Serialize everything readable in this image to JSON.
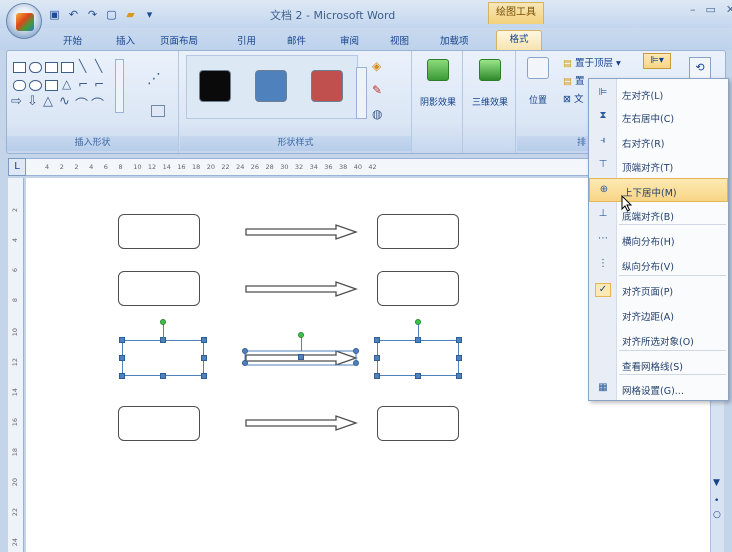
{
  "window": {
    "title": "文档 2 - Microsoft Word",
    "context_tab_group": "绘图工具",
    "controls": [
      "–",
      "▭",
      "✕"
    ]
  },
  "qat": {
    "icons": [
      "save-icon",
      "undo-icon",
      "redo-icon",
      "new-doc-icon",
      "open-folder-icon",
      "customize-qat-icon"
    ]
  },
  "tabs": [
    "开始",
    "插入",
    "页面布局",
    "引用",
    "邮件",
    "审阅",
    "视图",
    "加载项",
    "格式"
  ],
  "ribbon": {
    "groups": {
      "insert_shapes": "插入形状",
      "shape_styles": "形状样式",
      "shadow_effects": "阴影效果",
      "3d_effects": "三维效果",
      "position": "位置",
      "arrange_partial": "排"
    },
    "buttons": {
      "bring_front": "置于顶层",
      "send_back": "置",
      "text_wrap": "文",
      "shadow": "阴影效果",
      "threed": "三维效果",
      "position": "位置"
    },
    "swatch_colors": [
      "#0a0a0a",
      "#4f81bd",
      "#c0504d"
    ]
  },
  "ruler": {
    "ticks": [
      "4",
      "2",
      "2",
      "4",
      "6",
      "8",
      "10",
      "12",
      "14",
      "16",
      "18",
      "20",
      "22",
      "24",
      "26",
      "28",
      "30",
      "32",
      "34",
      "36",
      "38",
      "40",
      "42"
    ]
  },
  "vruler": {
    "ticks": [
      "2",
      "4",
      "6",
      "8",
      "10",
      "12",
      "14",
      "16",
      "18",
      "20",
      "22",
      "24"
    ]
  },
  "align_menu": {
    "items": [
      {
        "label": "左对齐(L)",
        "icon": "align-left-icon"
      },
      {
        "label": "左右居中(C)",
        "icon": "align-center-icon"
      },
      {
        "label": "右对齐(R)",
        "icon": "align-right-icon"
      },
      {
        "label": "顶端对齐(T)",
        "icon": "align-top-icon"
      },
      {
        "label": "上下居中(M)",
        "icon": "align-middle-icon",
        "highlighted": true
      },
      {
        "label": "底端对齐(B)",
        "icon": "align-bottom-icon"
      },
      {
        "label": "横向分布(H)",
        "icon": "distribute-horizontal-icon"
      },
      {
        "label": "纵向分布(V)",
        "icon": "distribute-vertical-icon"
      },
      {
        "label": "对齐页面(P)",
        "icon": "check-icon",
        "checked": true
      },
      {
        "label": "对齐边距(A)",
        "icon": ""
      },
      {
        "label": "对齐所选对象(O)",
        "icon": ""
      },
      {
        "label": "查看网格线(S)",
        "icon": ""
      },
      {
        "label": "网格设置(G)...",
        "icon": "grid-icon"
      }
    ]
  }
}
